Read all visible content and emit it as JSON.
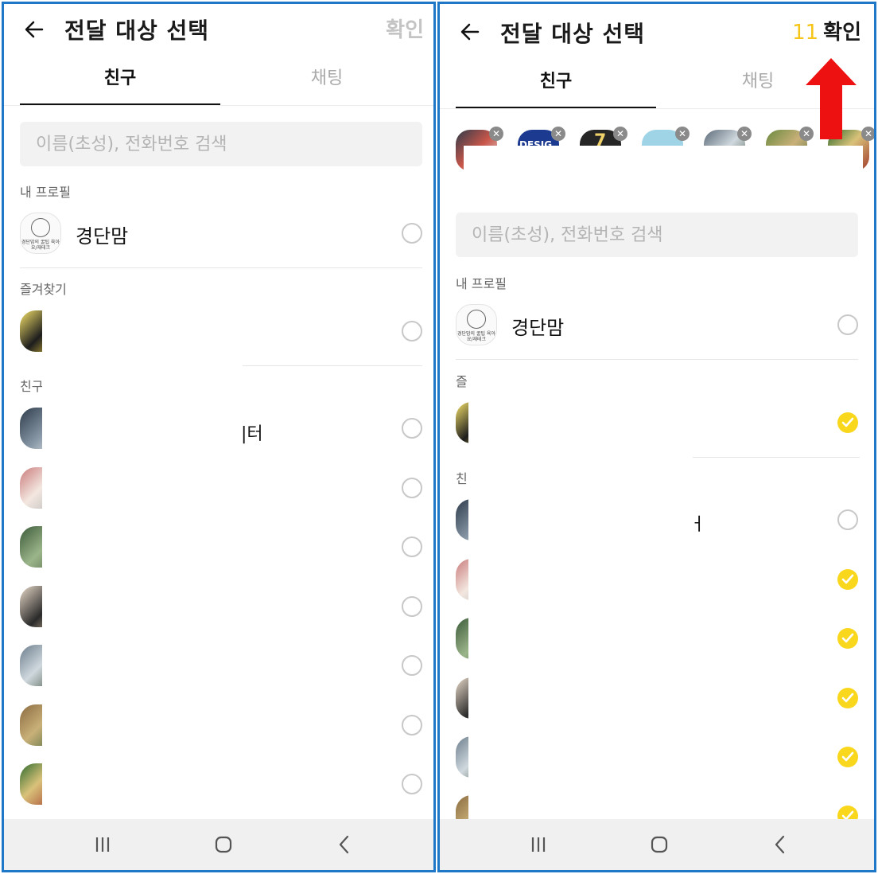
{
  "left": {
    "header": {
      "title": "전달 대상 선택",
      "confirm_label": "확인"
    },
    "tabs": [
      "친구",
      "채팅"
    ],
    "search_placeholder": "이름(초성), 전화번호 검색",
    "sections": {
      "my_profile": "내 프로필",
      "favorites": "즐겨찾기",
      "friends_partial": "친구"
    },
    "my_profile": {
      "name": "경단맘",
      "logo_text": "경단맘의 꿀팁 육아요/재테크"
    },
    "friend_fragment": "|터"
  },
  "right": {
    "header": {
      "title": "전달 대상 선택",
      "selected_count": "11",
      "confirm_label": "확인"
    },
    "tabs": [
      "친구",
      "채팅"
    ],
    "chip_labels": [
      "DESIG",
      "7"
    ],
    "search_placeholder": "이름(초성), 전화번호 검색",
    "sections": {
      "my_profile": "내 프로필",
      "favorites_partial": "즐",
      "friends_partial": "친"
    },
    "my_profile": {
      "name": "경단맘",
      "logo_text": "경단맘의 꿀팁 육아요/재테크"
    },
    "friend_fragment": "ㅓ"
  },
  "colors": {
    "accent_yellow": "#f9d71c",
    "count_yellow": "#f5c518",
    "annotation_arrow": "#ee1111",
    "panel_border": "#1f77c8"
  },
  "icons": {
    "back": "arrow-left-icon",
    "recent_apps": "recent-apps-icon",
    "home": "home-icon",
    "back_nav": "chevron-left-icon",
    "check": "check-icon",
    "remove": "close-icon"
  }
}
